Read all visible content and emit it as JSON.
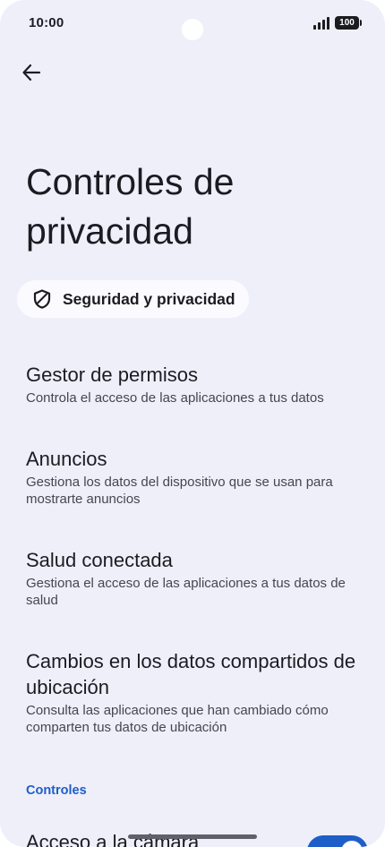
{
  "status_bar": {
    "time": "10:00",
    "battery": "100"
  },
  "header": {
    "title": "Controles de privacidad",
    "back_icon": "arrow-left-icon"
  },
  "chip": {
    "label": "Seguridad y privacidad",
    "icon": "shield-icon"
  },
  "items": [
    {
      "title": "Gestor de permisos",
      "subtitle": "Controla el acceso de las aplicaciones a tus datos"
    },
    {
      "title": "Anuncios",
      "subtitle": "Gestiona los datos del dispositivo que se usan para mostrarte anuncios"
    },
    {
      "title": "Salud conectada",
      "subtitle": "Gestiona el acceso de las aplicaciones a tus datos de salud"
    },
    {
      "title": "Cambios en los datos compartidos de ubicación",
      "subtitle": "Consulta las aplicaciones que han cambiado cómo comparten tus datos de ubicación"
    }
  ],
  "section": {
    "header": "Controles"
  },
  "camera_access": {
    "title": "Acceso a la cámara",
    "enabled": true
  },
  "colors": {
    "background": "#efeff9",
    "accent": "#1d5ec9",
    "text": "#1b1c22",
    "secondary_text": "#45464f"
  }
}
